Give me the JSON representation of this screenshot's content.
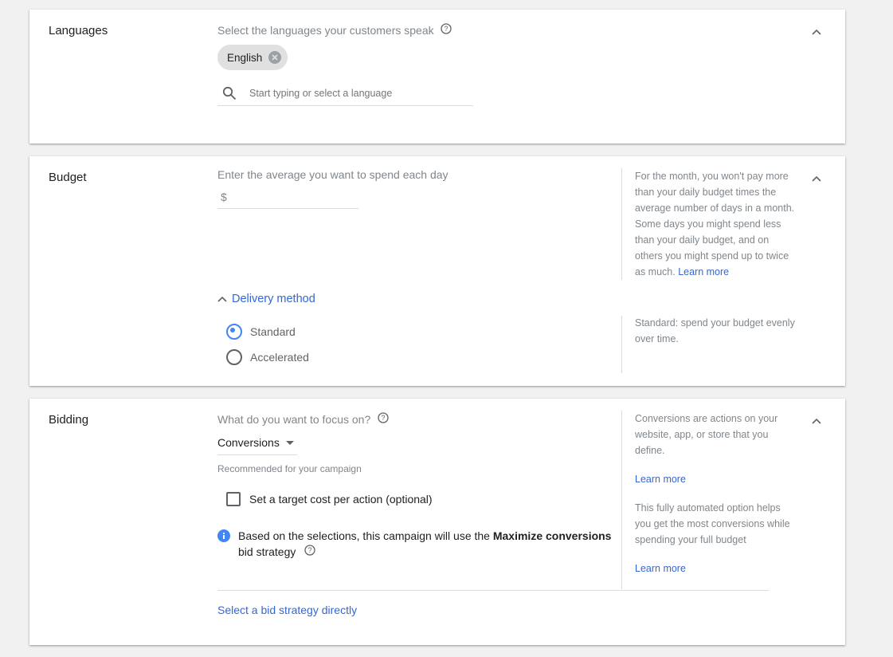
{
  "languages": {
    "title": "Languages",
    "prompt": "Select the languages your customers speak",
    "chip_label": "English",
    "search_placeholder": "Start typing or select a language"
  },
  "budget": {
    "title": "Budget",
    "prompt": "Enter the average you want to spend each day",
    "currency_symbol": "$",
    "amount_value": "",
    "side_text": "For the month, you won't pay more than your daily budget times the average number of days in a month. Some days you might spend less than your daily budget, and on others you might spend up to twice as much.",
    "side_link": "Learn more",
    "delivery_label": "Delivery method",
    "options": [
      "Standard",
      "Accelerated"
    ],
    "selected_option": "Standard",
    "delivery_side_text": "Standard: spend your budget evenly over time."
  },
  "bidding": {
    "title": "Bidding",
    "prompt": "What do you want to focus on?",
    "dropdown_value": "Conversions",
    "recommended_text": "Recommended for your campaign",
    "checkbox_label": "Set a target cost per action (optional)",
    "info_text_before": "Based on the selections, this campaign will use the ",
    "info_text_bold": "Maximize conversions",
    "info_text_after": "bid strategy",
    "side_text_1": "Conversions are actions on your website, app, or store that you define.",
    "side_link_1": "Learn more",
    "side_text_2": "This fully automated option helps you get the most conversions while spending your full budget",
    "side_link_2": "Learn more",
    "select_strategy_link": "Select a bid strategy directly"
  },
  "colors": {
    "accent": "#4285f4",
    "link": "#3367d6",
    "muted_text": "#80868b",
    "background": "#f1f1f1"
  }
}
